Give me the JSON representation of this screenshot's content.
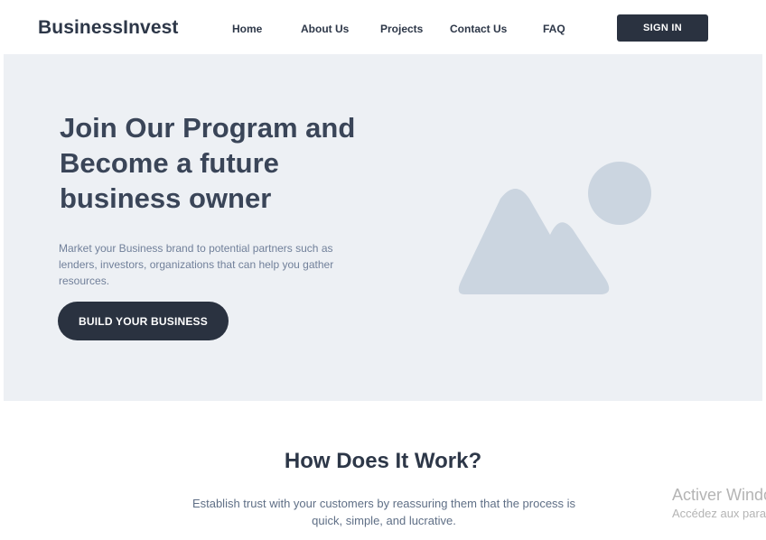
{
  "header": {
    "brand": "BusinessInvest",
    "nav": [
      "Home",
      "About Us",
      "Projects",
      "Contact Us",
      "FAQ"
    ],
    "sign_in": "SIGN IN"
  },
  "hero": {
    "title": "Join Our Program and Become a future business owner",
    "description": "Market your Business brand to potential partners such as lenders, investors, organizations that can help you gather resources.",
    "cta": "BUILD YOUR BUSINESS",
    "image_icon": "image-placeholder-icon"
  },
  "how_it_works": {
    "title": "How Does It Work?",
    "description": "Establish trust with your customers by reassuring them that the process is quick, simple, and lucrative."
  },
  "watermark": {
    "line1": "Activer Windows",
    "line2": "Accédez aux paramètres"
  },
  "colors": {
    "primary_dark": "#2a3240",
    "hero_bg": "#edf0f4",
    "placeholder": "#cbd5e0"
  }
}
